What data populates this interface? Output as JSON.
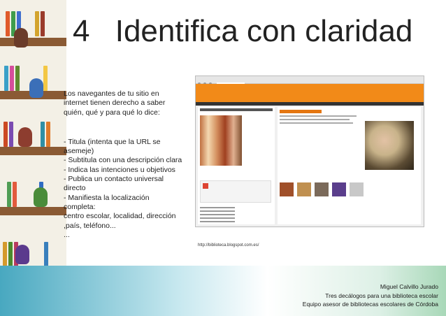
{
  "slide": {
    "number": "4",
    "title": "Identifica con claridad"
  },
  "text": {
    "lines_intro": [
      "Los navegantes de tu sitio en",
      "internet tienen derecho a saber",
      "quién, qué y para qué lo dice:"
    ],
    "lines_list": [
      "- Titula (intenta que la URL se",
      "asemeje)",
      "- Subtitula con una descripción clara",
      "- Indica las intenciones u objetivos",
      "- Publica un contacto universal",
      "directo",
      "- Manifiesta la localización completa:",
      "centro escolar, localidad, dirección",
      ",país, teléfono...",
      "..."
    ]
  },
  "screenshot_caption_url": "http://biblioteca.blogspot.com.es/",
  "footer": {
    "author": "Miguel Calvillo Jurado",
    "subtitle": "Tres decálogos para una biblioteca escolar",
    "team": "Equipo asesor de bibliotecas escolares de Córdoba"
  },
  "colors": {
    "blog_header": "#f28a18",
    "post_title": "#e47611"
  }
}
